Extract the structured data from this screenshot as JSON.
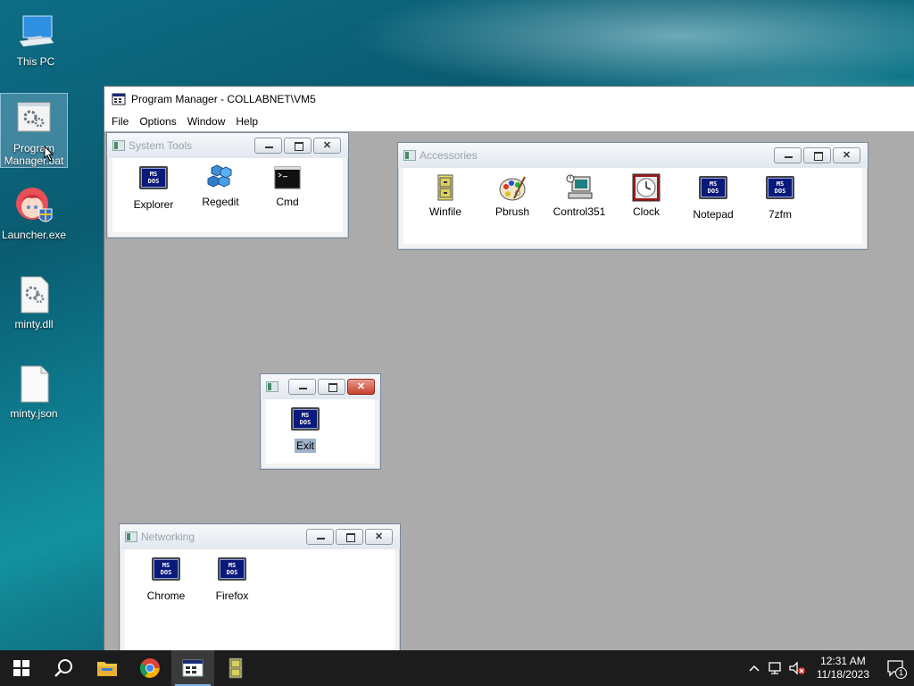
{
  "desktop": {
    "icons": [
      {
        "label": "This PC"
      },
      {
        "label": "Program Manager.bat"
      },
      {
        "label": "Launcher.exe"
      },
      {
        "label": "minty.dll"
      },
      {
        "label": "minty.json"
      }
    ]
  },
  "program_manager": {
    "title": "Program Manager - COLLABNET\\VM5",
    "menu": [
      "File",
      "Options",
      "Window",
      "Help"
    ],
    "groups": {
      "system_tools": {
        "title": "System Tools",
        "items": [
          "Explorer",
          "Regedit",
          "Cmd"
        ]
      },
      "accessories": {
        "title": "Accessories",
        "items": [
          "Winfile",
          "Pbrush",
          "Control351",
          "Clock",
          "Notepad",
          "7zfm"
        ]
      },
      "untitled": {
        "title": "",
        "items": [
          "Exit"
        ]
      },
      "networking": {
        "title": "Networking",
        "items": [
          "Chrome",
          "Firefox"
        ]
      }
    },
    "msdos_text": [
      "MS",
      "DOS"
    ]
  },
  "taskbar": {
    "time": "12:31 AM",
    "date": "11/18/2023",
    "notification_count": "1"
  },
  "colors": {
    "taskbar": "#1c1c1c",
    "mdi_background": "#ababab",
    "msdos_blue": "#0a1a7a",
    "selection": "#9fb3c8"
  }
}
